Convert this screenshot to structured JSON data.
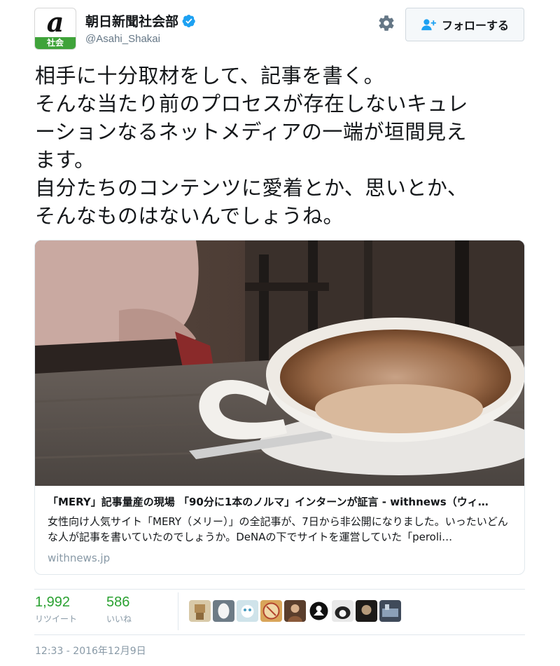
{
  "profile": {
    "avatar_logo": "a",
    "avatar_badge": "社会",
    "display_name": "朝日新聞社会部",
    "handle": "@Asahi_Shakai",
    "verified": true
  },
  "actions": {
    "follow_label": "フォローする",
    "settings_icon": "gear-icon",
    "follow_icon": "add-user-icon"
  },
  "tweet": {
    "lines": [
      "相手に十分取材をして、記事を書く。",
      "そんな当たり前のプロセスが存在しないキュレ",
      "ーションなるネットメディアの一端が垣間見え",
      "ます。",
      "自分たちのコンテンツに愛着とか、思いとか、",
      "そんなものはないんでしょうね。"
    ]
  },
  "card": {
    "title": "「MERY」記事量産の現場 「90分に1本のノルマ」インターンが証言 - withnews（ウィ…",
    "description": "女性向け人気サイト「MERY（メリー）」の全記事が、7日から非公開になりました。いったいどんな人が記事を書いていたのでしょうか。DeNAの下でサイトを運営していた「peroli…",
    "domain": "withnews.jp"
  },
  "stats": {
    "retweets": {
      "count": "1,992",
      "label": "リツイート"
    },
    "likes": {
      "count": "586",
      "label": "いいね"
    }
  },
  "timestamp": "12:33 - 2016年12月9日",
  "colors": {
    "accent_green": "#2aa131",
    "verified_blue": "#1da1f2",
    "muted_text": "#8899a6",
    "badge_green": "#3fa33a"
  }
}
